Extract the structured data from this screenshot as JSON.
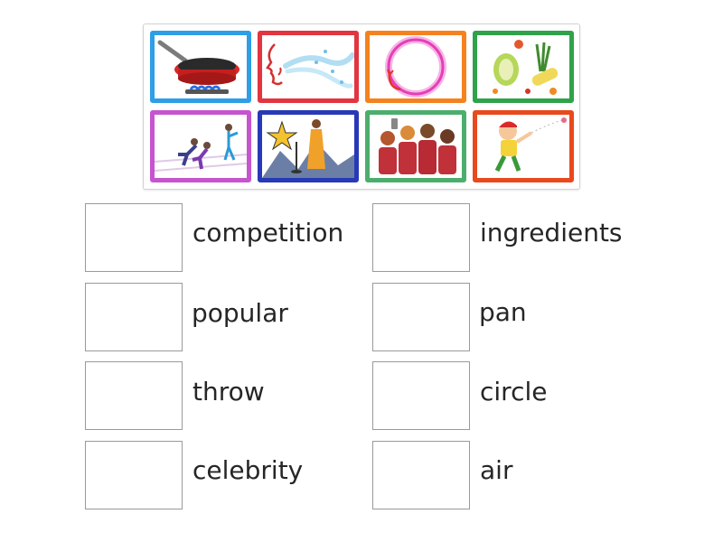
{
  "cards": [
    {
      "icon": "frying-pan-on-stove-icon",
      "border": "#2e9ee6"
    },
    {
      "icon": "face-blowing-air-icon",
      "border": "#e23540"
    },
    {
      "icon": "glowing-circle-icon",
      "border": "#f5821f"
    },
    {
      "icon": "vegetable-ingredients-icon",
      "border": "#2fa24a"
    },
    {
      "icon": "running-race-icon",
      "border": "#c654cf"
    },
    {
      "icon": "celebrity-on-stage-icon",
      "border": "#2839b8"
    },
    {
      "icon": "group-of-friends-selfie-icon",
      "border": "#4cae6d"
    },
    {
      "icon": "boy-throwing-ball-icon",
      "border": "#e8491d"
    }
  ],
  "pairs": {
    "competition": "competition",
    "ingredients": "ingredients",
    "popular": "popular",
    "pan": "pan",
    "throw": "throw",
    "circle": "circle",
    "celebrity": "celebrity",
    "air": "air"
  }
}
